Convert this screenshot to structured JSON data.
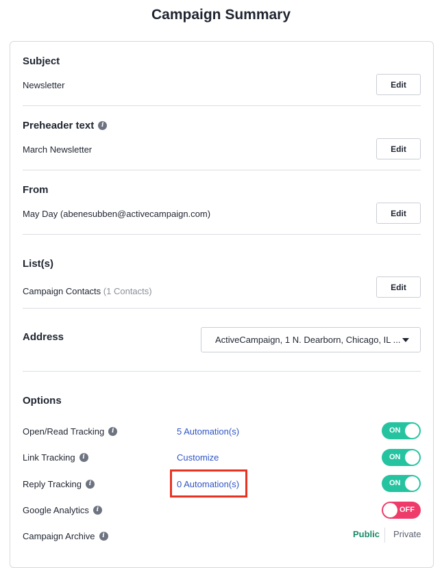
{
  "page": {
    "title": "Campaign Summary"
  },
  "subject": {
    "title": "Subject",
    "value": "Newsletter",
    "edit_label": "Edit"
  },
  "preheader": {
    "title": "Preheader text",
    "value": "March Newsletter",
    "edit_label": "Edit",
    "info_glyph": "i"
  },
  "from": {
    "title": "From",
    "value": "May Day (abenesubben@activecampaign.com)",
    "edit_label": "Edit"
  },
  "lists": {
    "title": "List(s)",
    "value": "Campaign Contacts",
    "count": "(1 Contacts)",
    "edit_label": "Edit"
  },
  "address": {
    "title": "Address",
    "selected": "ActiveCampaign, 1 N. Dearborn, Chicago, IL ..."
  },
  "options": {
    "title": "Options",
    "rows": [
      {
        "label": "Open/Read Tracking",
        "link": "5 Automation(s)",
        "toggle": "ON",
        "state": "on"
      },
      {
        "label": "Link Tracking",
        "link": "Customize",
        "toggle": "ON",
        "state": "on"
      },
      {
        "label": "Reply Tracking",
        "link": "0 Automation(s)",
        "toggle": "ON",
        "state": "on"
      },
      {
        "label": "Google Analytics",
        "link": "",
        "toggle": "OFF",
        "state": "off"
      }
    ],
    "archive": {
      "label": "Campaign Archive",
      "public_label": "Public",
      "private_label": "Private",
      "selected": "Public"
    }
  },
  "icons": {
    "info": "info-icon",
    "dropdown": "chevron-down-icon"
  },
  "colors": {
    "toggle_on": "#25c3a0",
    "toggle_off": "#ee3b6a",
    "link": "#2f55c8",
    "highlight": "#e8321f",
    "public_selected": "#1a8a6a"
  }
}
